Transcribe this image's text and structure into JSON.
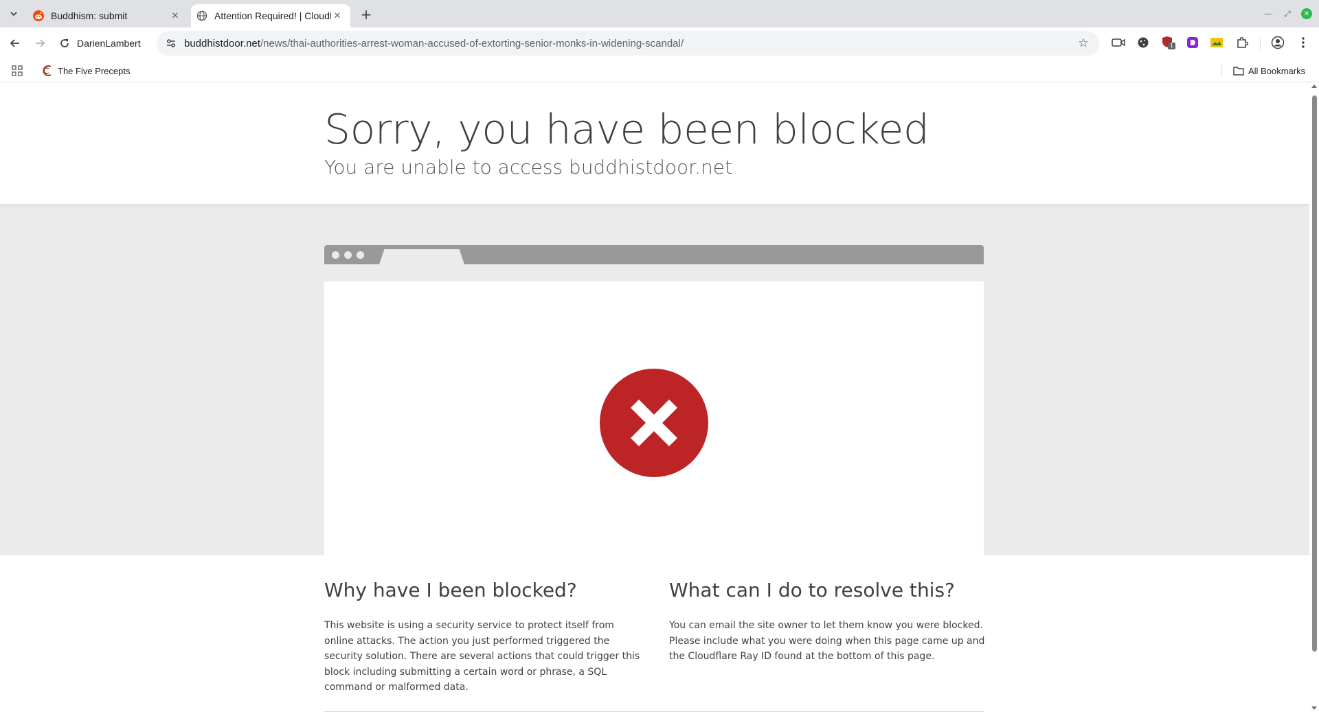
{
  "browser": {
    "tabs": [
      {
        "title": "Buddhism: submit",
        "favicon": "reddit-icon",
        "active": false
      },
      {
        "title": "Attention Required! | Cloudflare",
        "favicon": "globe-icon",
        "active": true
      }
    ],
    "profile_name": "DarienLambert",
    "url_host": "buddhistdoor.net",
    "url_path": "/news/thai-authorities-arrest-woman-accused-of-extorting-senior-monks-in-widening-scandal/",
    "bookmarks": [
      {
        "label": "The Five Precepts",
        "icon": "five-precepts-icon"
      }
    ],
    "all_bookmarks_label": "All Bookmarks",
    "extension_badge": "1"
  },
  "page": {
    "title": "Sorry, you have been blocked",
    "subtitle": "You are unable to access buddhistdoor.net",
    "why": {
      "heading": "Why have I been blocked?",
      "body": "This website is using a security service to protect itself from online attacks. The action you just performed triggered the security solution. There are several actions that could trigger this block including submitting a certain word or phrase, a SQL command or malformed data."
    },
    "resolve": {
      "heading": "What can I do to resolve this?",
      "body": "You can email the site owner to let them know you were blocked. Please include what you were doing when this page came up and the Cloudflare Ray ID found at the bottom of this page."
    }
  },
  "colors": {
    "block_icon": "#bd2426",
    "grey_band": "#ebebeb",
    "mock_bar": "#999999",
    "text": "#404040"
  }
}
